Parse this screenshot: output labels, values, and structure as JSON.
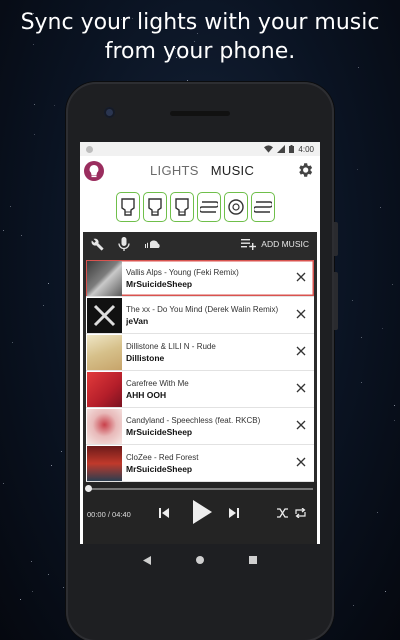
{
  "headline": {
    "line1": "Sync your lights with your music",
    "line2": "from your phone."
  },
  "status_bar": {
    "time": "4:00",
    "icons": [
      "wifi-icon",
      "signal-icon",
      "battery-icon"
    ]
  },
  "app": {
    "tabs": [
      {
        "label": "LIGHTS",
        "active": false
      },
      {
        "label": "MUSIC",
        "active": true
      }
    ],
    "lights": [
      "bulb-gu10",
      "bulb-gu10",
      "bulb-gu10",
      "lightstrip",
      "bulb-round",
      "lightstrip"
    ],
    "light_border_color": "#6fbf4a"
  },
  "toolbar": {
    "add_music_label": "ADD MUSIC",
    "icons": [
      "wrench-icon",
      "microphone-icon",
      "soundcloud-icon",
      "playlist-add-icon"
    ]
  },
  "playlist": [
    {
      "title": "Vallis Alps - Young (Feki Remix)",
      "artist": "MrSuicideSheep",
      "active": true
    },
    {
      "title": "The xx - Do You Mind (Derek Walin Remix)",
      "artist": "jeVan",
      "active": false
    },
    {
      "title": "Dillistone & LILI N - Rude",
      "artist": "Dillistone",
      "active": false
    },
    {
      "title": "Carefree With Me",
      "artist": "AHH OOH",
      "active": false
    },
    {
      "title": "Candyland - Speechless (feat. RKCB)",
      "artist": "MrSuicideSheep",
      "active": false
    },
    {
      "title": "CloZee - Red Forest",
      "artist": "MrSuicideSheep",
      "active": false
    }
  ],
  "player": {
    "time": "00:00 / 04:40",
    "progress": 0
  },
  "nav": [
    "back-icon",
    "home-icon",
    "recents-icon"
  ]
}
